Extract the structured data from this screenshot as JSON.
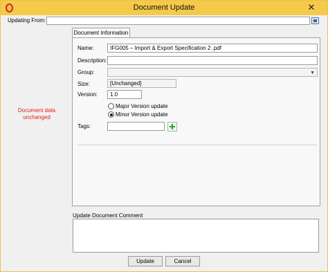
{
  "window": {
    "title": "Document Update",
    "close_glyph": "✕"
  },
  "updating_from": {
    "label": "Updating From:",
    "value": ""
  },
  "status": {
    "message": "Document data unchanged",
    "color": "#e02020"
  },
  "tabs": [
    {
      "label": "Document Information",
      "active": true
    }
  ],
  "form": {
    "name": {
      "label": "Name:",
      "value": "IFG005 – Import & Export Specification 2 .pdf"
    },
    "description": {
      "label": "Description:",
      "value": ""
    },
    "group": {
      "label": "Group:",
      "value": ""
    },
    "size": {
      "label": "Size:",
      "value": "[Unchanged]"
    },
    "version": {
      "label": "Version:",
      "value": "1.0"
    },
    "version_type": {
      "options": [
        {
          "label": "Major Version update",
          "checked": false
        },
        {
          "label": "Minor Version update",
          "checked": true
        }
      ]
    },
    "tags": {
      "label": "Tags:",
      "value": ""
    }
  },
  "comment": {
    "label": "Update Document Comment",
    "value": ""
  },
  "buttons": {
    "update": "Update",
    "cancel": "Cancel"
  },
  "icons": {
    "app": "app-logo-icon",
    "browse": "browse-icon",
    "add_tag": "add-tag-plus-icon"
  },
  "colors": {
    "titlebar": "#f5c94a",
    "accent_error": "#e02020",
    "add_icon": "#2e9b2e"
  }
}
